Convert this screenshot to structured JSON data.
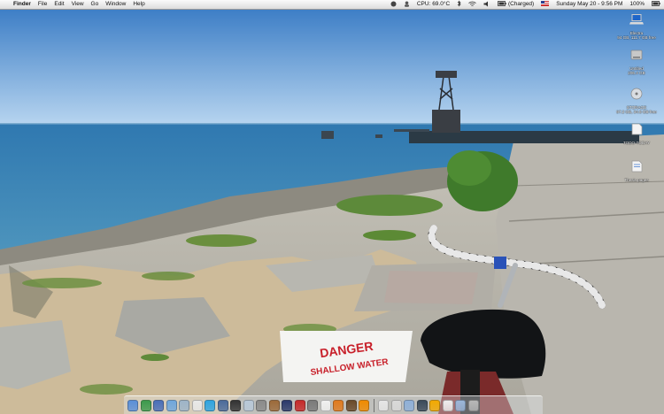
{
  "menubar": {
    "apple_glyph": "",
    "app_name": "Finder",
    "menus": [
      "File",
      "Edit",
      "View",
      "Go",
      "Window",
      "Help"
    ],
    "cpu_temp": "CPU: 69.0°C",
    "battery_status": "(Charged)",
    "datetime": "Sunday May 20 - 9:56 PM",
    "battery_percent": "100%"
  },
  "desktop_icons": [
    {
      "name": "Electra",
      "info": "94 GB, 111.7 GB free",
      "icon": "laptop-icon"
    },
    {
      "name": "Untitled",
      "info": "206.4 GB",
      "icon": "hard-drive-icon"
    },
    {
      "name": "STORAGE",
      "info": "97.2 GB, 34.6 GB free",
      "icon": "disk-icon"
    },
    {
      "name": "TODO-TODAY",
      "info": "",
      "icon": "document-icon"
    },
    {
      "name": "Thesis.pages",
      "info": "",
      "icon": "document-icon"
    }
  ],
  "wallpaper": {
    "sign_line1": "DANGER",
    "sign_line2": "SHALLOW WATER",
    "colors": {
      "sky_top": "#3f7fc6",
      "sky_bottom": "#b4d3ef",
      "water": "#3a85b4",
      "concrete": "#b8b5ab",
      "sign_red": "#c8202a"
    }
  },
  "dock": {
    "apps": [
      {
        "icon": "finder-icon",
        "color": "#5a8fd8"
      },
      {
        "icon": "dashboard-icon",
        "color": "#3c9a4c"
      },
      {
        "icon": "itunes-icon",
        "color": "#4a6fb8"
      },
      {
        "icon": "safari-icon",
        "color": "#6fa6dc"
      },
      {
        "icon": "mail-icon",
        "color": "#9db4c8"
      },
      {
        "icon": "ical-icon",
        "color": "#e8e8e8"
      },
      {
        "icon": "skype-icon",
        "color": "#2fa4e0"
      },
      {
        "icon": "quicktime-icon",
        "color": "#4b6b9b"
      },
      {
        "icon": "terminal-icon",
        "color": "#333333"
      },
      {
        "icon": "preview-icon",
        "color": "#b8c8d8"
      },
      {
        "icon": "system-preferences-icon",
        "color": "#8a8a8a"
      },
      {
        "icon": "address-book-icon",
        "color": "#9c6a3a"
      },
      {
        "icon": "photoshop-icon",
        "color": "#2b3a6b"
      },
      {
        "icon": "acrobat-icon",
        "color": "#c62a2a"
      },
      {
        "icon": "automator-icon",
        "color": "#7a7a7a"
      },
      {
        "icon": "textedit-icon",
        "color": "#f0f0f0"
      },
      {
        "icon": "firefox-icon",
        "color": "#e07a1e"
      },
      {
        "icon": "dictionary-icon",
        "color": "#6a4a2a"
      },
      {
        "icon": "vlc-icon",
        "color": "#f08a00"
      }
    ],
    "docs": [
      {
        "icon": "document-icon",
        "color": "#e6e6e6"
      },
      {
        "icon": "document-icon",
        "color": "#d9d9d9"
      },
      {
        "icon": "folder-icon",
        "color": "#8fb0d8"
      },
      {
        "icon": "screen-icon",
        "color": "#3a4a5a"
      },
      {
        "icon": "bitcoin-icon",
        "color": "#f2a900"
      },
      {
        "icon": "document-icon",
        "color": "#eeeeee"
      },
      {
        "icon": "folder-icon",
        "color": "#9bb7da"
      },
      {
        "icon": "trash-icon",
        "color": "#b8b8b8"
      }
    ]
  }
}
